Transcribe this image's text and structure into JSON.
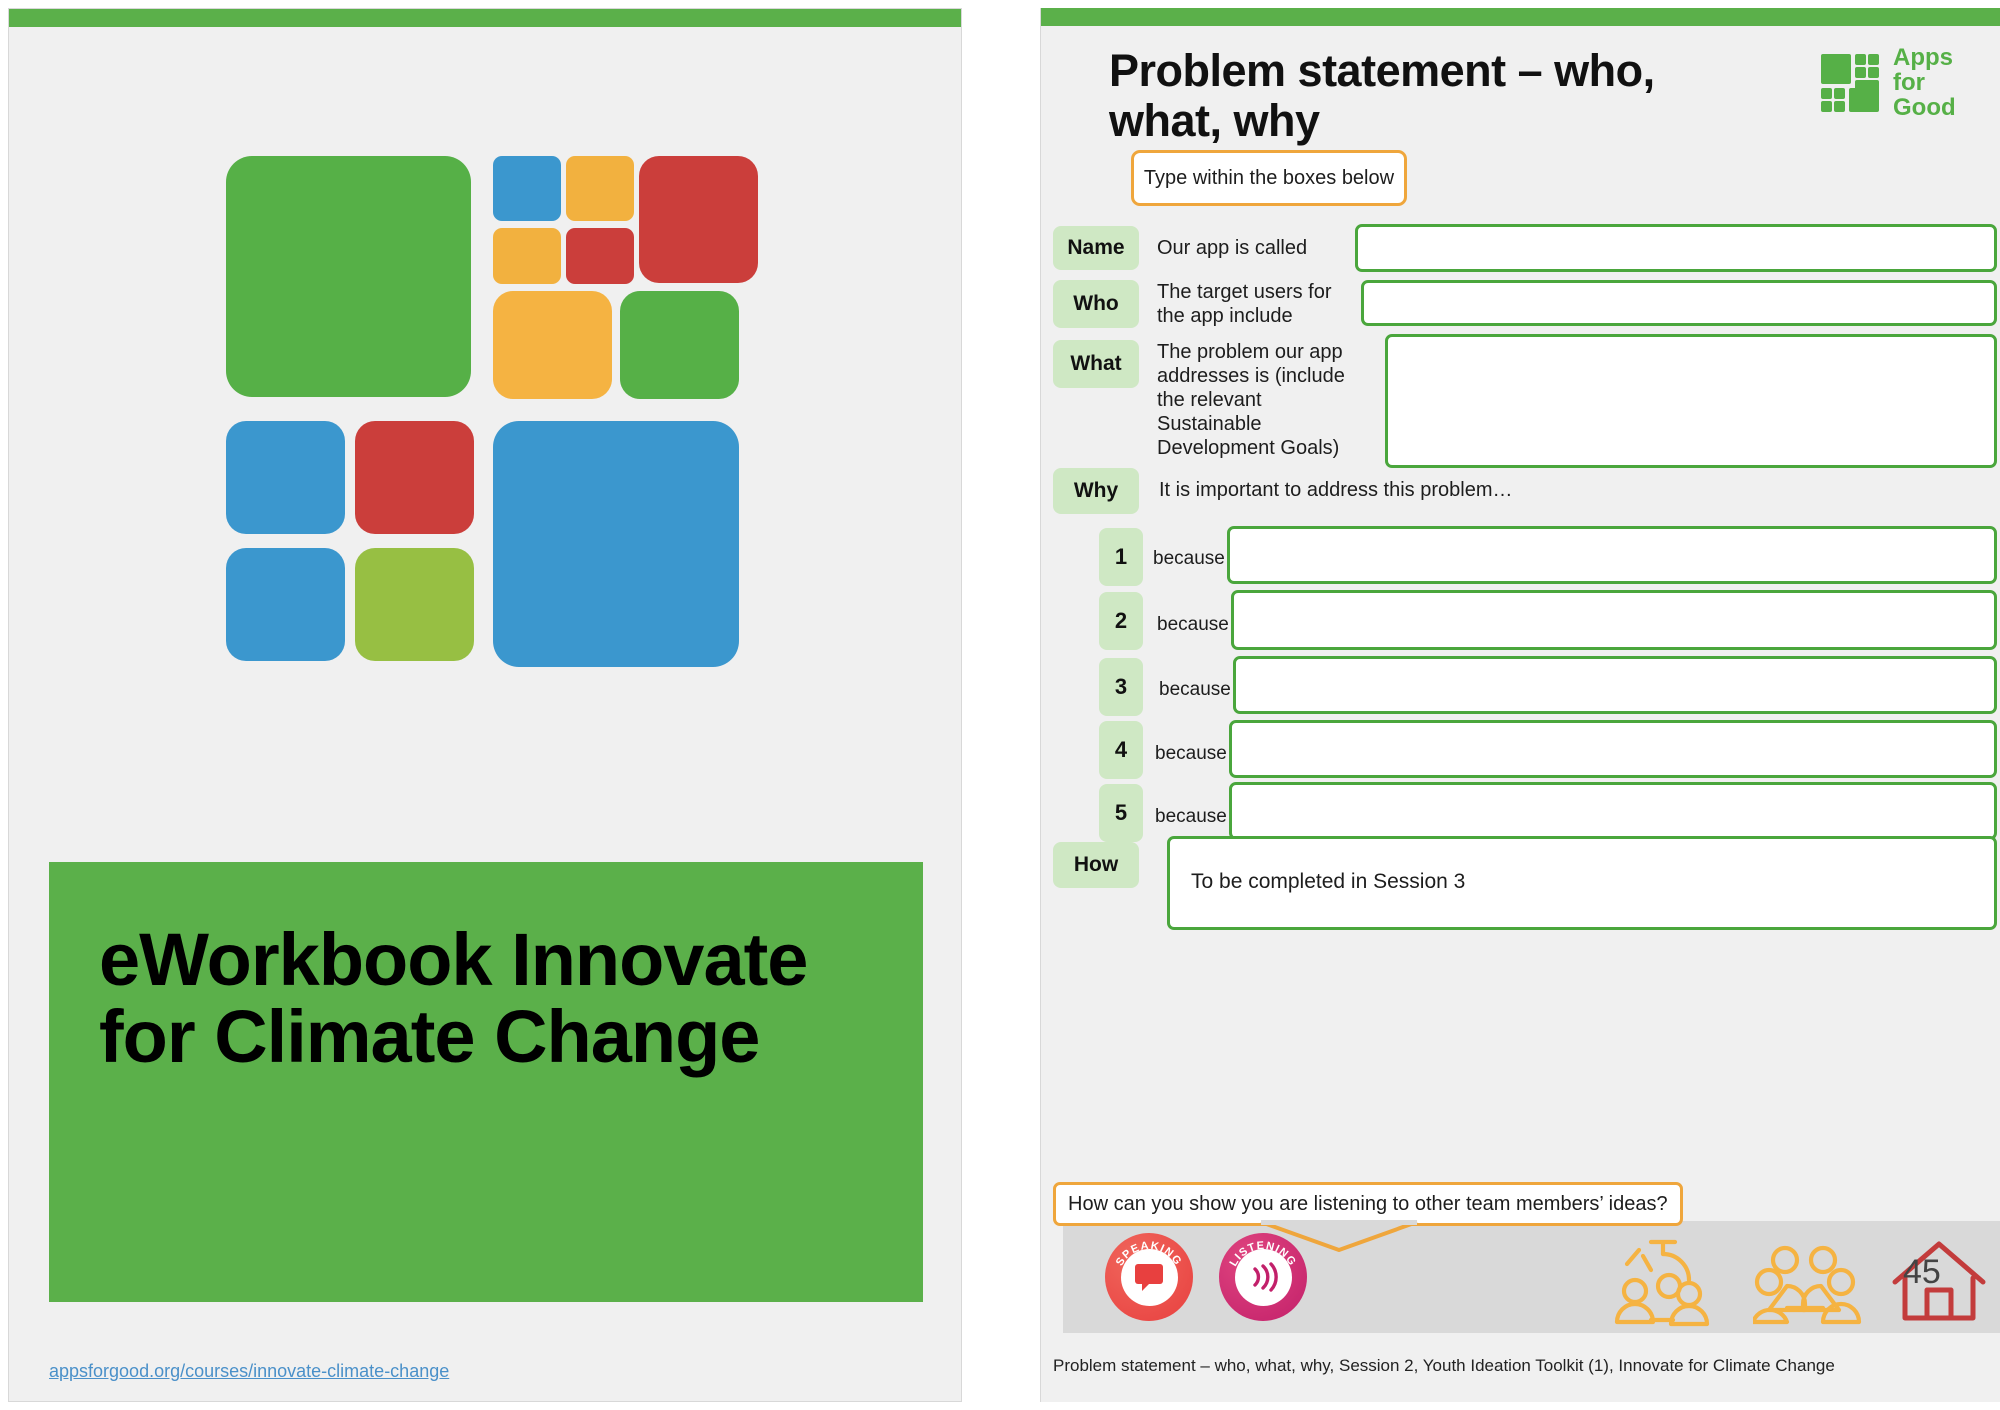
{
  "cover": {
    "title": "eWorkbook Innovate for Climate Change",
    "link": "appsforgood.org/courses/innovate-climate-change",
    "logo_name": "apps-for-good-tile-logo",
    "colors": {
      "green": "#56b047",
      "blue": "#3b97ce",
      "amber": "#f2b13f",
      "red": "#cb3e3b",
      "olive": "#97bf43",
      "panel_green": "#5bb04a"
    }
  },
  "slide": {
    "title": "Problem statement – who, what, why",
    "brand": {
      "line1": "Apps",
      "line2": "for",
      "line3": "Good",
      "color": "#56b047"
    },
    "instruction": "Type within the boxes below",
    "rows": [
      {
        "label": "Name",
        "prompt": "Our app is called",
        "value": ""
      },
      {
        "label": "Who",
        "prompt": "The target users for the app include",
        "value": ""
      },
      {
        "label": "What",
        "prompt": "The problem our app addresses is (include the relevant Sustainable Development Goals)",
        "value": ""
      }
    ],
    "why": {
      "label": "Why",
      "prompt": "It is important to address this problem…",
      "items": [
        {
          "number": "1",
          "connector": "because",
          "value": ""
        },
        {
          "number": "2",
          "connector": "because",
          "value": ""
        },
        {
          "number": "3",
          "connector": "because",
          "value": ""
        },
        {
          "number": "4",
          "connector": "because",
          "value": ""
        },
        {
          "number": "5",
          "connector": "because",
          "value": ""
        }
      ]
    },
    "how": {
      "label": "How",
      "value": "To be completed in Session 3"
    },
    "listening_callout": "How can you show you are listening to other team members’ ideas?",
    "badges": [
      {
        "name": "speaking",
        "label": "SPEAKING",
        "color": "#e8403f"
      },
      {
        "name": "listening",
        "label": "LISTENING",
        "color": "#c2206a"
      }
    ],
    "footer_icons": [
      {
        "name": "teacher-and-students-icon",
        "color": "#f5b342"
      },
      {
        "name": "group-of-people-icon",
        "color": "#f5b342"
      },
      {
        "name": "home-icon",
        "color": "#c33c3c"
      }
    ],
    "page_number": "45",
    "caption": "Problem statement – who, what, why, Session 2, Youth Ideation Toolkit (1), Innovate for Climate Change",
    "accents": {
      "orange": "#efa63c",
      "green_border": "#4aa63c",
      "pill_green": "#cfe8c4"
    }
  }
}
